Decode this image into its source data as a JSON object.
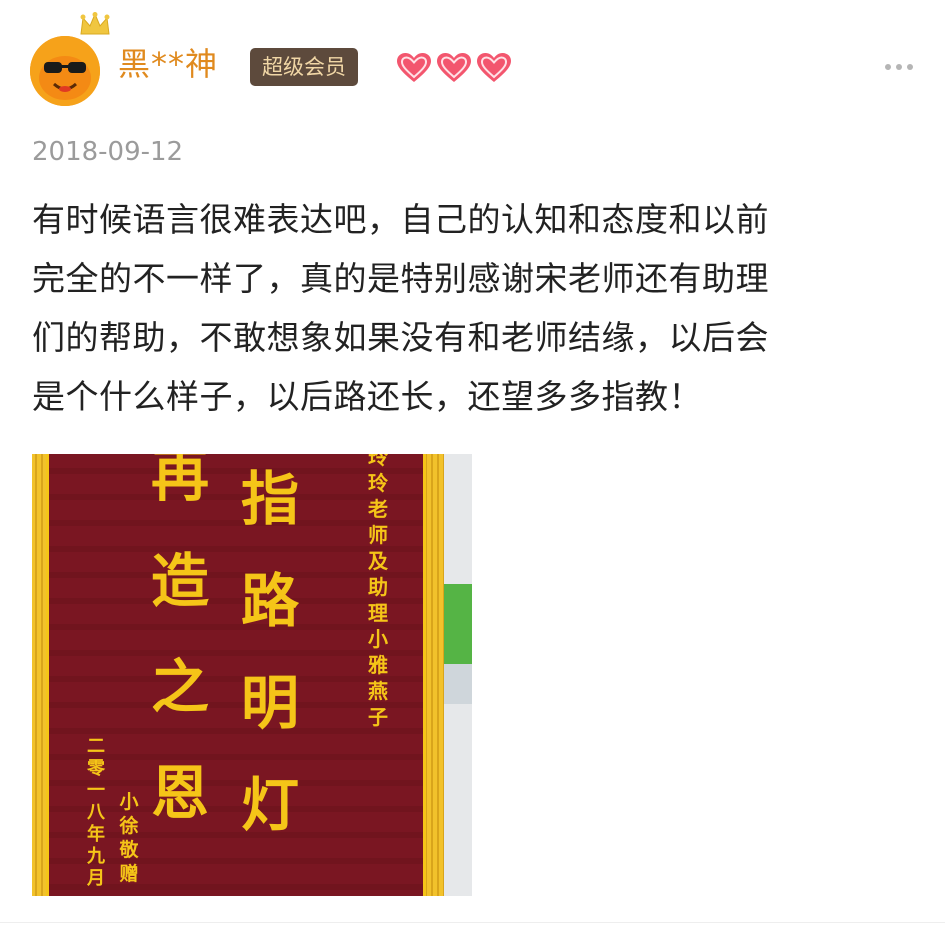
{
  "post": {
    "username": "黑**神",
    "member_badge": "超级会员",
    "date": "2018-09-12",
    "content": "有时候语言很难表达吧，自己的认知和态度和以前\n完全的不一样了，真的是特别感谢宋老师还有助理\n们的帮助，不敢想象如果没有和老师结缘，以后会\n是个什么样子，以后路还长，还望多多指教！",
    "heart_count": 3,
    "icons": {
      "avatar": "avatar-icon",
      "crown": "crown-icon",
      "heart": "heart-icon",
      "more": "more-icon"
    }
  },
  "banner": {
    "middle_column": "指路明灯",
    "left_column": "再造之恩",
    "recipient": "玲玲老师及助理小雅燕子",
    "sender": "小徐敬赠",
    "date": "二零一八年九月"
  },
  "colors": {
    "username": "#e08a1e",
    "badge_bg": "#5d4a3c",
    "badge_text": "#f1d7a6",
    "banner_red": "#7a1622",
    "banner_gold": "#f5c518"
  }
}
